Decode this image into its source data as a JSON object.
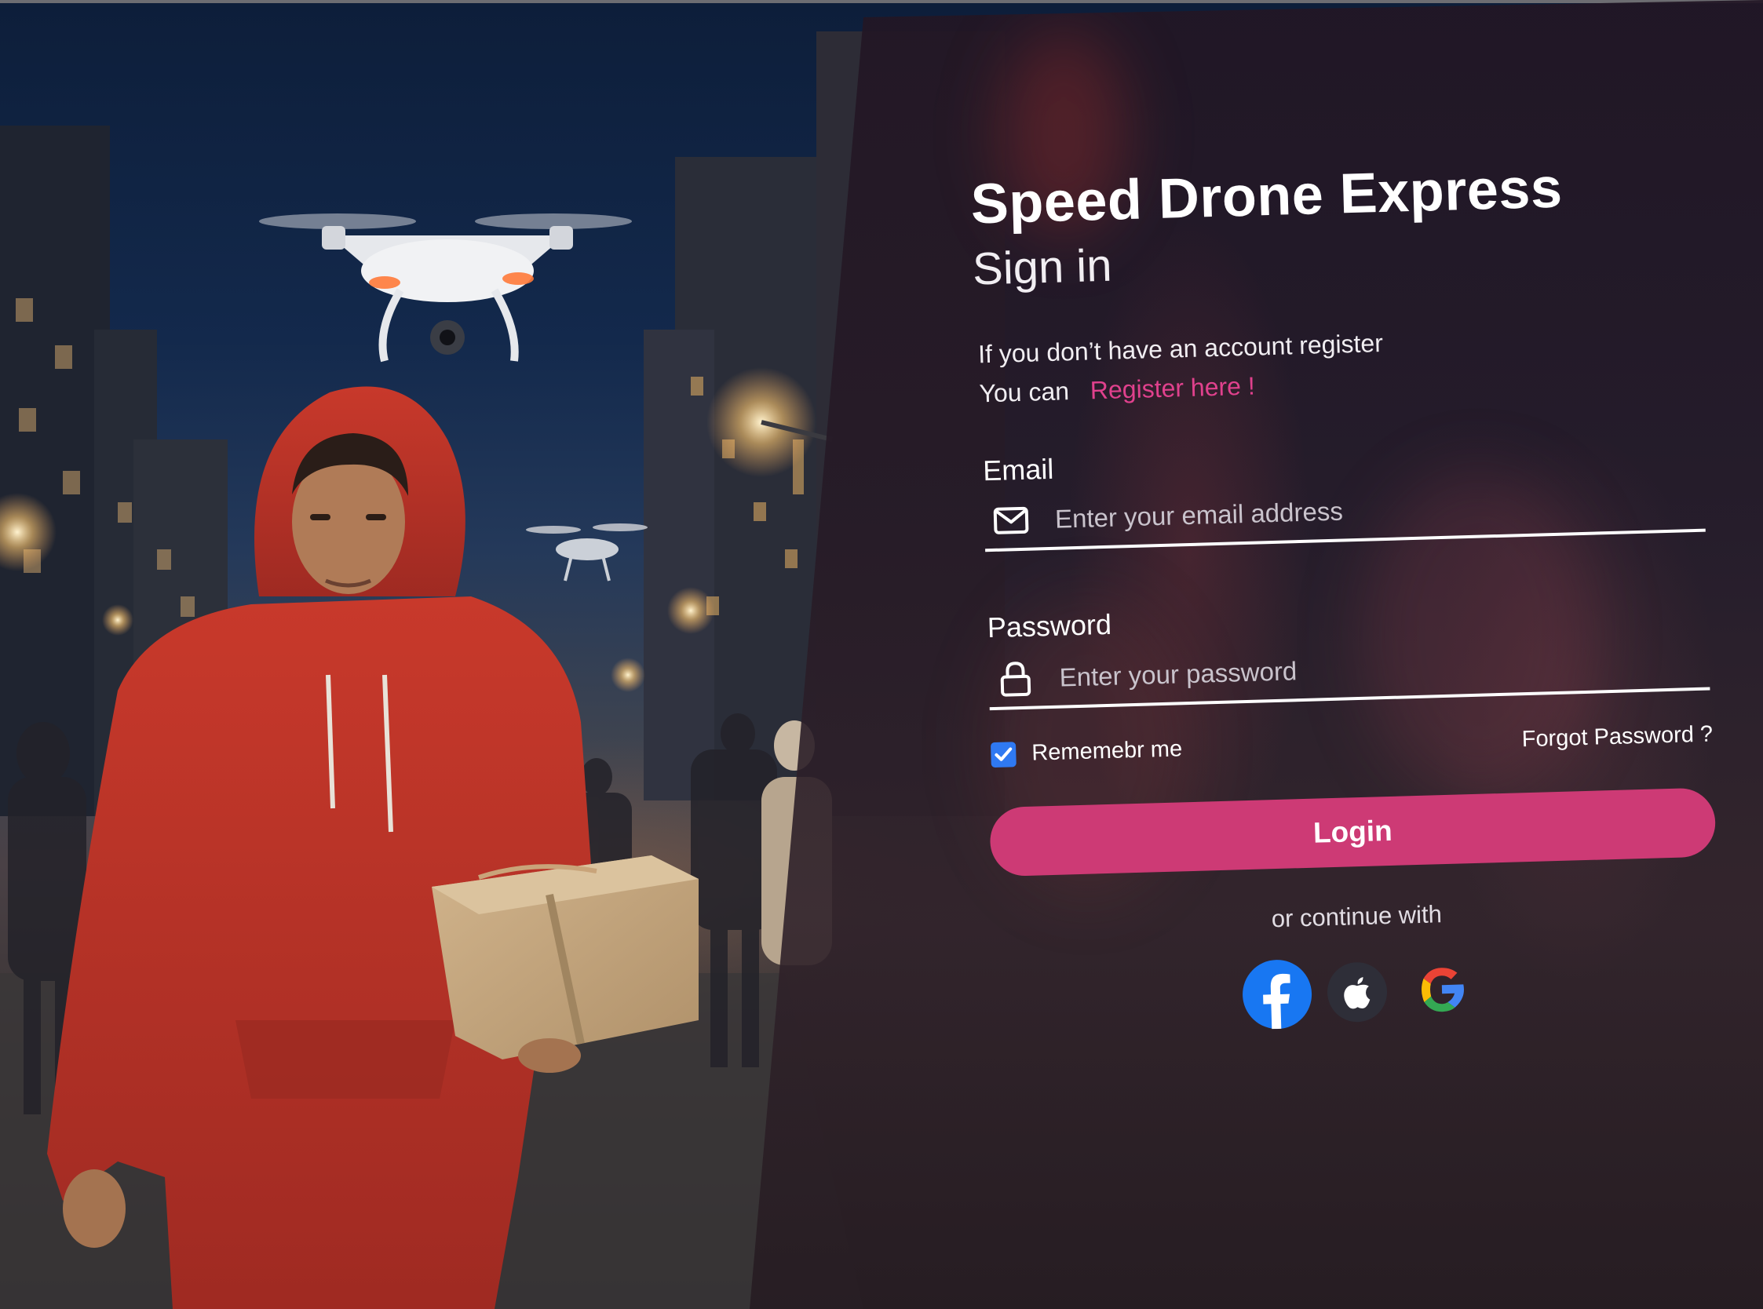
{
  "brand": "Speed Drone Express",
  "heading": "Sign in",
  "register_prompt": {
    "line1": "If you don’t have an account register",
    "line2_prefix": "You can",
    "link": "Register here !"
  },
  "email": {
    "label": "Email",
    "placeholder": "Enter your email address",
    "icon": "envelope-icon"
  },
  "password": {
    "label": "Password",
    "placeholder": "Enter your password",
    "icon": "lock-icon"
  },
  "remember": {
    "label": "Rememebr me",
    "checked": true
  },
  "forgot_label": "Forgot Password ?",
  "login_label": "Login",
  "continue_label": "or continue with",
  "social_providers": [
    "facebook-icon",
    "apple-icon",
    "google-icon"
  ],
  "colors": {
    "accent": "#cd3a75",
    "link": "#e0418d",
    "checkbox": "#2f79f2",
    "facebook": "#1877f2"
  }
}
